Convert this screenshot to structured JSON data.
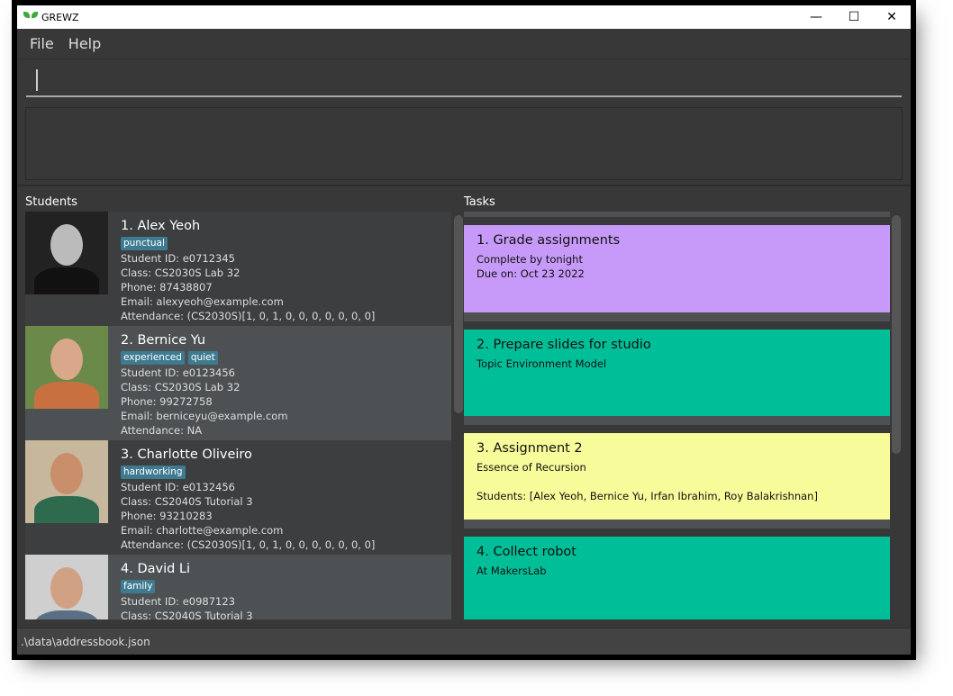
{
  "window": {
    "title": "GREWZ",
    "minimize": "—",
    "maximize": "☐",
    "close": "✕"
  },
  "menu": [
    "File",
    "Help"
  ],
  "command": {
    "value": ""
  },
  "result": {
    "text": ""
  },
  "students_header": "Students",
  "tasks_header": "Tasks",
  "students": [
    {
      "name": "1.  Alex Yeoh",
      "tags": [
        "punctual"
      ],
      "id": "Student ID: e0712345",
      "cls": "Class: CS2030S Lab 32",
      "phone": "Phone: 87438807",
      "email": "Email: alexyeoh@example.com",
      "attendance": "Attendance: (CS2030S)[1, 0, 1, 0, 0, 0, 0, 0, 0, 0]"
    },
    {
      "name": "2.  Bernice Yu",
      "tags": [
        "experienced",
        "quiet"
      ],
      "id": "Student ID: e0123456",
      "cls": "Class: CS2030S Lab 32",
      "phone": "Phone: 99272758",
      "email": "Email: berniceyu@example.com",
      "attendance": "Attendance: NA"
    },
    {
      "name": "3.  Charlotte Oliveiro",
      "tags": [
        "hardworking"
      ],
      "id": "Student ID: e0132456",
      "cls": "Class: CS2040S Tutorial 3",
      "phone": "Phone: 93210283",
      "email": "Email: charlotte@example.com",
      "attendance": "Attendance: (CS2030S)[1, 0, 1, 0, 0, 0, 0, 0, 0, 0]"
    },
    {
      "name": "4.  David Li",
      "tags": [
        "family"
      ],
      "id": "Student ID: e0987123",
      "cls": "Class: CS2040S Tutorial 3",
      "phone": "",
      "email": "",
      "attendance": ""
    }
  ],
  "tasks": [
    {
      "title": "1.  Grade assignments",
      "lines": [
        "Complete by tonight",
        "Due on: Oct 23 2022"
      ],
      "color": "#c79afa"
    },
    {
      "title": "2.  Prepare slides for studio",
      "lines": [
        "Topic Environment Model"
      ],
      "color": "#00bf98"
    },
    {
      "title": "3.  Assignment 2",
      "lines": [
        "Essence of Recursion",
        "",
        "Students: [Alex Yeoh, Bernice Yu, Irfan Ibrahim, Roy Balakrishnan]"
      ],
      "color": "#f8fb9a"
    },
    {
      "title": "4.  Collect robot",
      "lines": [
        "At MakersLab"
      ],
      "color": "#00bf98"
    }
  ],
  "status": ".\\data\\addressbook.json"
}
